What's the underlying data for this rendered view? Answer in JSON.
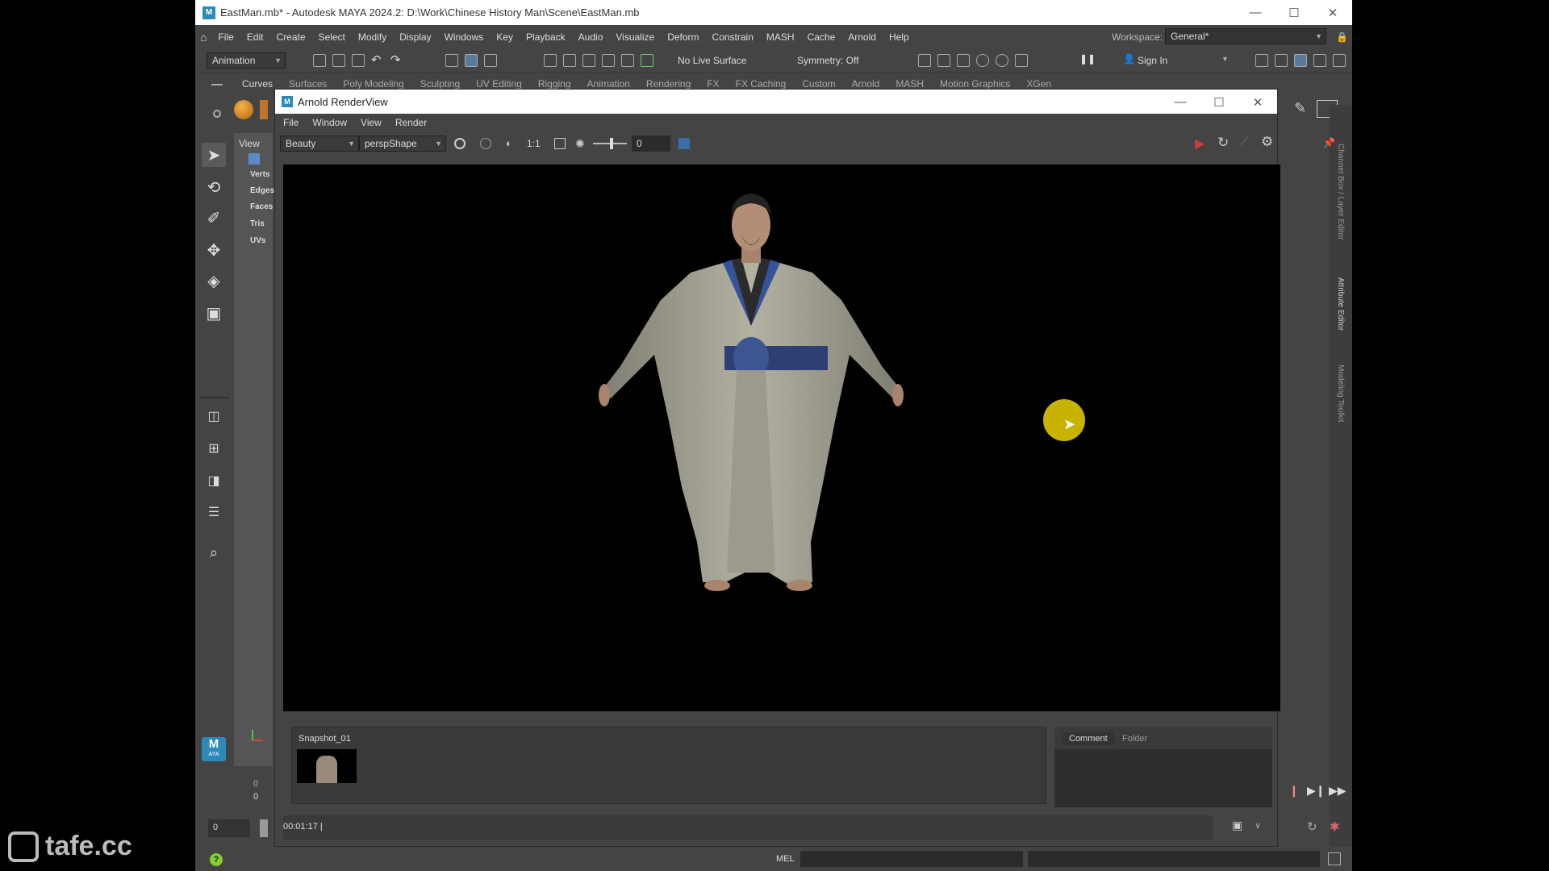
{
  "maya": {
    "title": "EastMan.mb* - Autodesk MAYA 2024.2: D:\\Work\\Chinese History Man\\Scene\\EastMan.mb",
    "app_icon": "M",
    "menu": [
      "File",
      "Edit",
      "Create",
      "Select",
      "Modify",
      "Display",
      "Windows",
      "Key",
      "Playback",
      "Audio",
      "Visualize",
      "Deform",
      "Constrain",
      "MASH",
      "Cache",
      "Arnold",
      "Help"
    ],
    "workspace_label": "Workspace:",
    "workspace_value": "General*",
    "menuset": "Animation",
    "live_surface": "No Live Surface",
    "symmetry": "Symmetry: Off",
    "sign_in": "Sign In",
    "shelf_tabs": [
      "Curves",
      "Surfaces",
      "Poly Modeling",
      "Sculpting",
      "UV Editing",
      "Rigging",
      "Animation",
      "Rendering",
      "FX",
      "FX Caching",
      "Custom",
      "Arnold",
      "MASH",
      "Motion Graphics",
      "XGen"
    ],
    "view_label": "View",
    "hud": [
      "Verts",
      "Edges",
      "Faces",
      "Tris",
      "UVs"
    ],
    "side_panels": [
      "Channel Box / Layer Editor",
      "Attribute Editor",
      "Modeling Toolkit"
    ],
    "time_values": [
      "0",
      "0"
    ],
    "frame_field": "0",
    "mel_label": "MEL",
    "logo_text": "AYA",
    "logo_letter": "M"
  },
  "renderview": {
    "title": "Arnold RenderView",
    "menu": [
      "File",
      "Window",
      "View",
      "Render"
    ],
    "aov": "Beauty",
    "camera": "perspShape",
    "ratio": "1:1",
    "exposure": "0",
    "snapshot_name": "Snapshot_01",
    "comment_tab": "Comment",
    "folder_tab": "Folder",
    "render_time": "00:01:17 |"
  },
  "watermark": "tafe.cc",
  "colors": {
    "accent": "#2b8ab8",
    "render_btn": "#d13a3a",
    "cursor": "#c8b400"
  }
}
